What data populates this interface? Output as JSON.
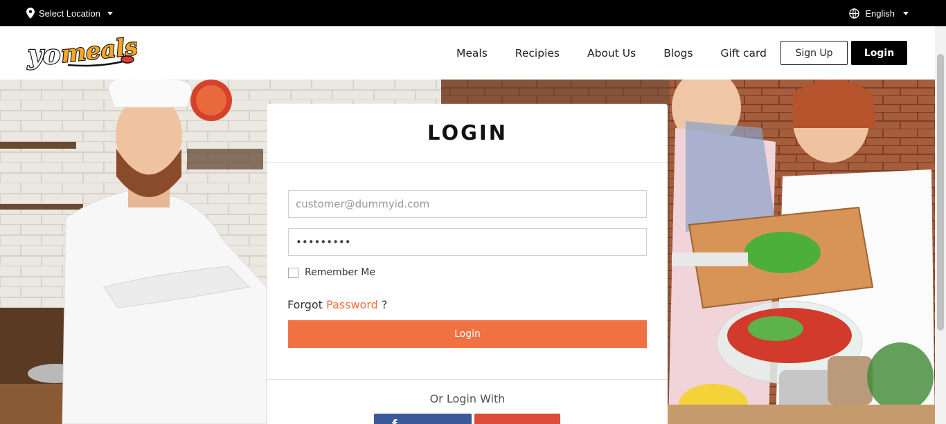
{
  "topbar": {
    "location_label": "Select Location",
    "language_label": "English"
  },
  "brand": {
    "logo_text": "yomeals"
  },
  "nav": {
    "items": [
      "Meals",
      "Recipies",
      "About Us",
      "Blogs",
      "Gift card"
    ],
    "signup_label": "Sign Up",
    "login_label": "Login"
  },
  "login": {
    "title": "LOGIN",
    "email_placeholder": "customer@dummyid.com",
    "password_value": "•••••••••",
    "remember_label": "Remember Me",
    "forgot_prefix": "Forgot",
    "forgot_link": "Password",
    "forgot_suffix": "?",
    "submit_label": "Login",
    "or_label": "Or Login With",
    "facebook_label": "f"
  },
  "colors": {
    "accent": "#f07142",
    "facebook": "#3b5998",
    "google": "#dd4b39",
    "topbar": "#000000"
  }
}
